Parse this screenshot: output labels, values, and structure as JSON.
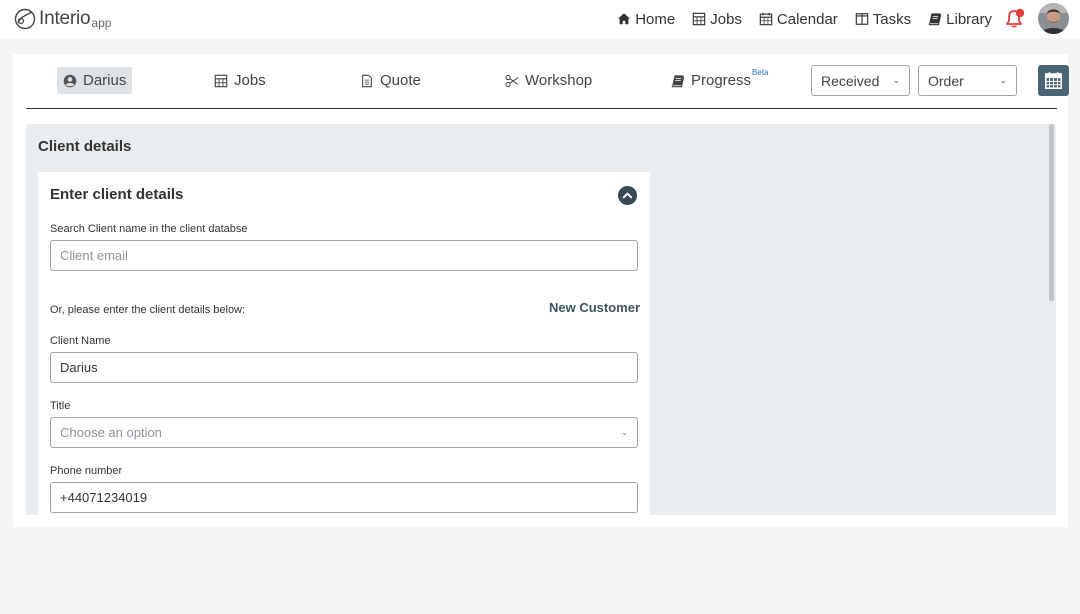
{
  "brand": {
    "name": "Interio",
    "suffix": "app"
  },
  "topnav": {
    "links": [
      {
        "label": "Home",
        "icon": "home-icon"
      },
      {
        "label": "Jobs",
        "icon": "calculator-icon"
      },
      {
        "label": "Calendar",
        "icon": "calendar-icon"
      },
      {
        "label": "Tasks",
        "icon": "columns-icon"
      },
      {
        "label": "Library",
        "icon": "book-icon"
      }
    ],
    "notification_icon": "bell-icon",
    "accent": "#e53e3e"
  },
  "tabs": [
    {
      "label": "Darius",
      "icon": "user-circle-icon",
      "active": true
    },
    {
      "label": "Jobs",
      "icon": "calculator-icon"
    },
    {
      "label": "Quote",
      "icon": "file-icon"
    },
    {
      "label": "Workshop",
      "icon": "scissors-icon"
    },
    {
      "label": "Progress",
      "icon": "book-icon",
      "badge": "Beta"
    }
  ],
  "status_select": {
    "value": "Received"
  },
  "type_select": {
    "value": "Order"
  },
  "client_details": {
    "title": "Client details",
    "form_title": "Enter client details",
    "search_label": "Search Client name in the client databse",
    "search_placeholder": "Client email",
    "or_text": "Or, please enter the client details below:",
    "new_customer": "New Customer",
    "name_label": "Client Name",
    "name_value": "Darius",
    "title_label": "Title",
    "title_placeholder": "Choose an option",
    "phone_label": "Phone number",
    "phone_value": "+44071234019"
  },
  "colors": {
    "primary": "#4a6474",
    "panel": "#e9edef",
    "tab_active": "#dfe3e6"
  }
}
